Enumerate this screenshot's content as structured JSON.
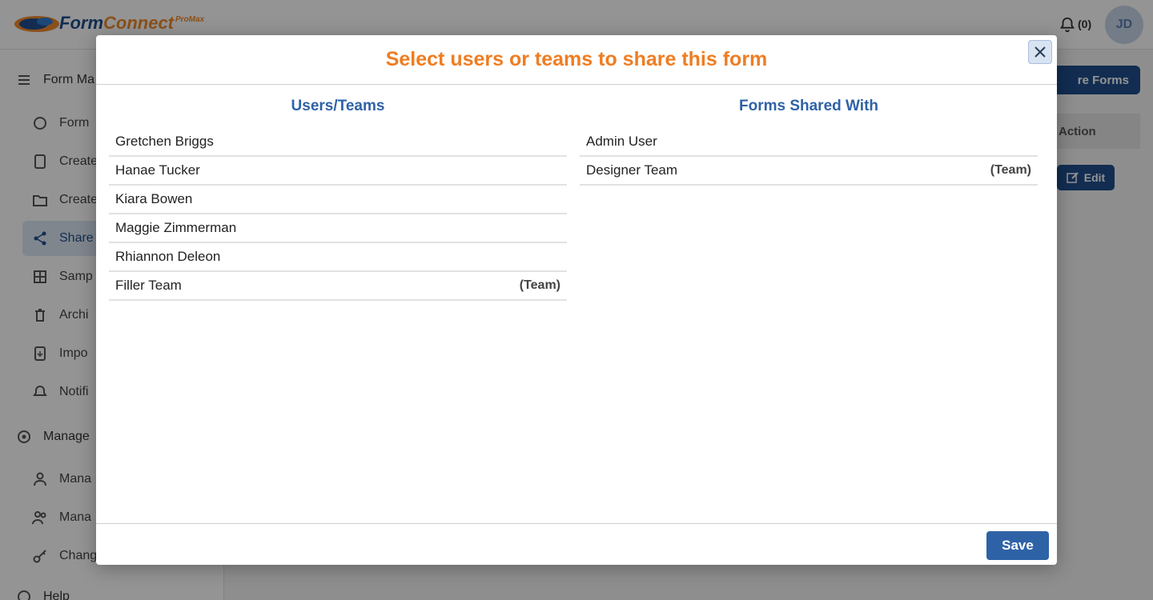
{
  "app": {
    "logo_text_primary": "Form",
    "logo_text_accent": "Connect",
    "logo_badge": "ProMax",
    "notification_count": "(0)",
    "avatar_initials": "JD"
  },
  "sidebar": {
    "groups": [
      {
        "label": "Form Ma",
        "icon": "list-icon"
      },
      {
        "label": "Manage",
        "icon": "gear-icon"
      },
      {
        "label": "Help",
        "icon": "help-icon"
      }
    ],
    "items": [
      {
        "label": "Form",
        "icon": "dashboard-icon"
      },
      {
        "label": "Create",
        "icon": "document-icon"
      },
      {
        "label": "Create",
        "icon": "folder-icon"
      },
      {
        "label": "Share",
        "icon": "share-icon"
      },
      {
        "label": "Samp",
        "icon": "grid-icon"
      },
      {
        "label": "Archi",
        "icon": "trash-icon"
      },
      {
        "label": "Impo",
        "icon": "import-icon"
      },
      {
        "label": "Notifi",
        "icon": "bell-icon"
      },
      {
        "label": "Mana",
        "icon": "user-icon"
      },
      {
        "label": "Mana",
        "icon": "users-icon"
      },
      {
        "label": "Chang",
        "icon": "key-icon"
      }
    ]
  },
  "main": {
    "share_button_label": "re Forms",
    "table_action_header": "Action",
    "edit_button_label": "Edit"
  },
  "modal": {
    "title": "Select users or teams to share this form",
    "left_column_title": "Users/Teams",
    "right_column_title": "Forms Shared With",
    "available": [
      {
        "name": "Gretchen Briggs",
        "tag": ""
      },
      {
        "name": "Hanae Tucker",
        "tag": ""
      },
      {
        "name": "Kiara Bowen",
        "tag": ""
      },
      {
        "name": "Maggie Zimmerman",
        "tag": ""
      },
      {
        "name": "Rhiannon Deleon",
        "tag": ""
      },
      {
        "name": "Filler Team",
        "tag": "(Team)"
      }
    ],
    "shared": [
      {
        "name": "Admin User",
        "tag": ""
      },
      {
        "name": "Designer Team",
        "tag": "(Team)"
      }
    ],
    "save_label": "Save"
  },
  "colors": {
    "title_orange": "#ef7d22",
    "heading_blue": "#2e62a6",
    "button_blue": "#2e62a6"
  }
}
